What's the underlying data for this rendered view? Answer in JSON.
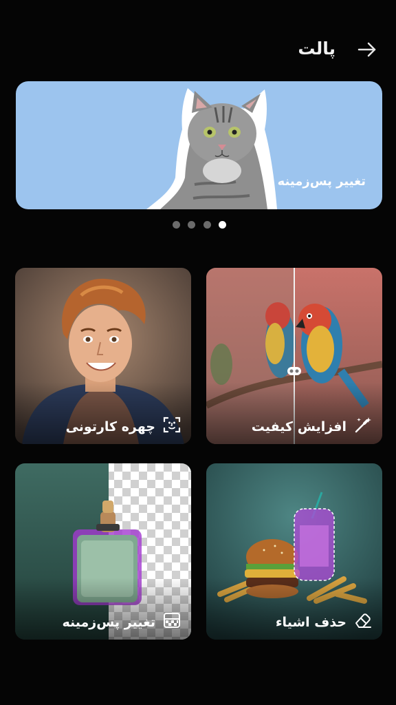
{
  "header": {
    "title": "پالت",
    "back_icon": "arrow-right-icon"
  },
  "banner": {
    "label": "تغییر پس‌زمینه",
    "color": "#9cc4ee"
  },
  "carousel": {
    "count": 4,
    "active_index": 3
  },
  "cards": [
    {
      "label": "افزایش کیفیت",
      "icon": "magic-wand-icon"
    },
    {
      "label": "چهره کارتونی",
      "icon": "face-scan-icon"
    },
    {
      "label": "حذف اشیاء",
      "icon": "eraser-icon"
    },
    {
      "label": "تغییر پس‌زمینه",
      "icon": "background-icon"
    }
  ]
}
